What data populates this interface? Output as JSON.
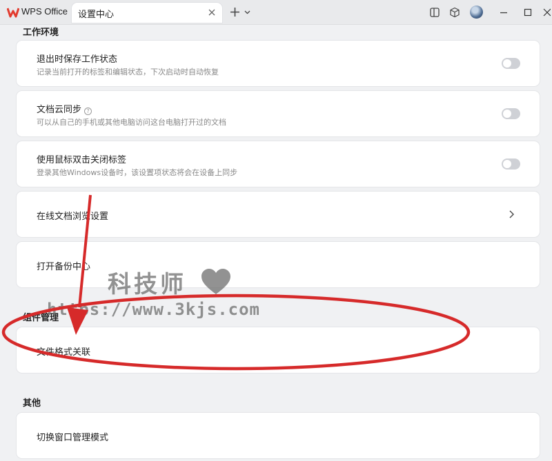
{
  "app": {
    "name": "WPS Office"
  },
  "tab": {
    "label": "设置中心"
  },
  "sections": [
    {
      "title": "工作环境",
      "items": [
        {
          "title": "退出时保存工作状态",
          "desc": "记录当前打开的标签和编辑状态，下次启动时自动恢复",
          "control": "toggle",
          "on": false
        },
        {
          "title": "文档云同步",
          "desc": "可以从自己的手机或其他电脑访问这台电脑打开过的文档",
          "control": "toggle",
          "on": false,
          "help": "?"
        },
        {
          "title": "使用鼠标双击关闭标签",
          "desc": "登录其他Windows设备时，该设置项状态将会在设备上同步",
          "control": "toggle",
          "on": false
        },
        {
          "title": "在线文档浏览设置",
          "control": "chevron"
        },
        {
          "title": "打开备份中心"
        }
      ]
    },
    {
      "title": "组件管理",
      "items": [
        {
          "title": "文件格式关联"
        }
      ]
    },
    {
      "title": "其他",
      "items": [
        {
          "title": "切换窗口管理模式"
        }
      ]
    }
  ],
  "watermark": {
    "title": "科技师",
    "url": "https://www.3kjs.com"
  },
  "colors": {
    "accent_red": "#d62a2a",
    "toggle_off": "#cfd1d6",
    "bg": "#f0f1f3"
  },
  "icons": [
    "wps-logo-icon",
    "close-icon",
    "plus-icon",
    "chevron-down-icon",
    "sidebar-toggle-icon",
    "cube-icon",
    "minimize-icon",
    "maximize-icon",
    "window-close-icon",
    "chevron-right-icon",
    "help-icon",
    "heart-icon"
  ]
}
